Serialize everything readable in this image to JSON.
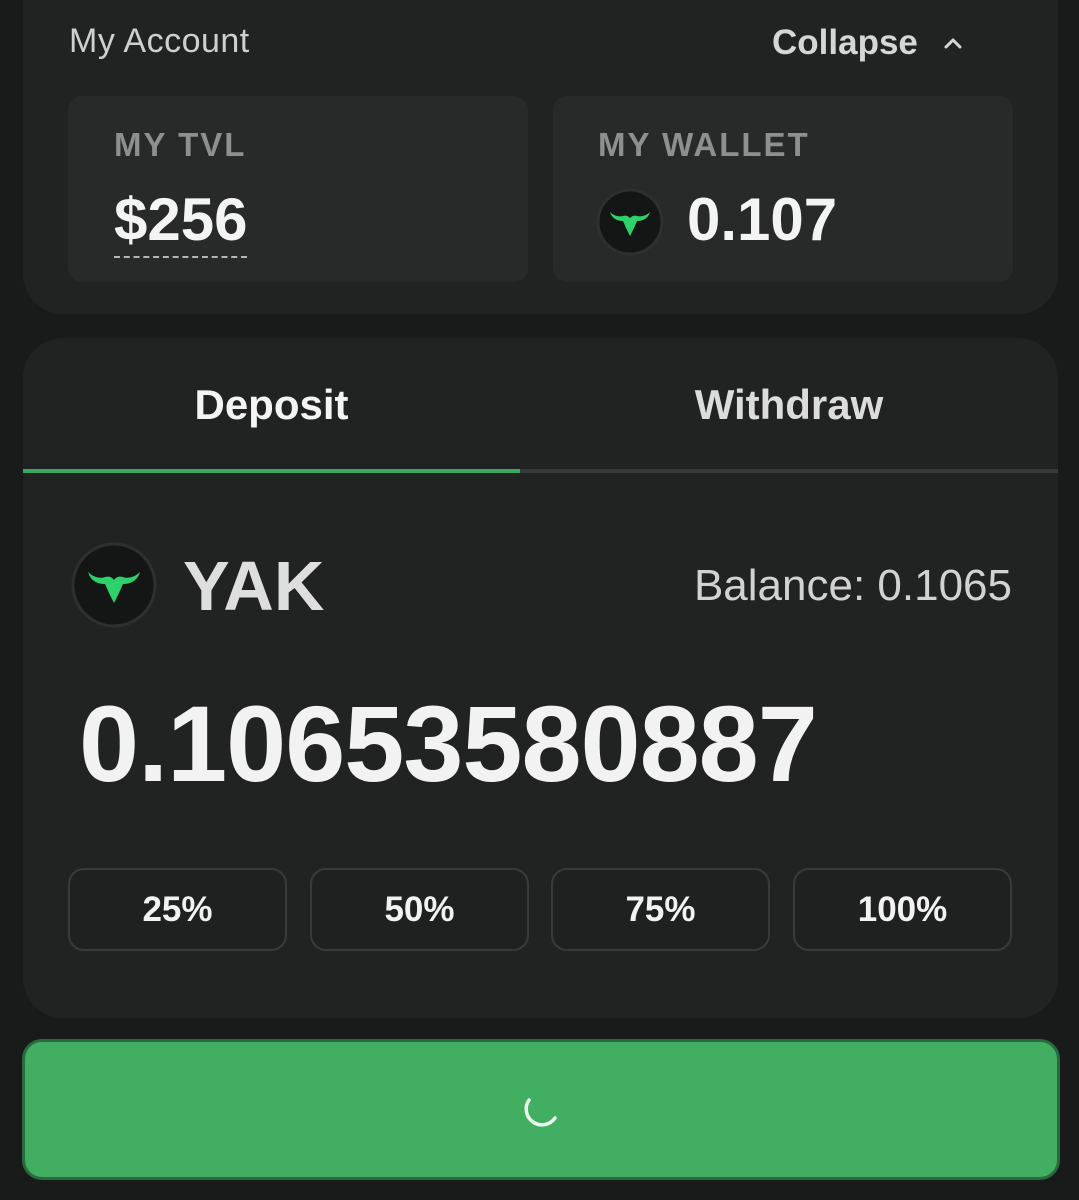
{
  "account": {
    "title": "My Account",
    "collapse_label": "Collapse",
    "tvl": {
      "label": "MY TVL",
      "value": "$256"
    },
    "wallet": {
      "label": "MY WALLET",
      "value": "0.107",
      "token_icon": "yak-bull-icon"
    }
  },
  "tabs": [
    {
      "label": "Deposit",
      "active": true
    },
    {
      "label": "Withdraw",
      "active": false
    }
  ],
  "deposit": {
    "token": {
      "name": "YAK",
      "icon": "yak-bull-icon"
    },
    "balance_text": "Balance: 0.1065",
    "amount_value": "0.10653580887",
    "percent_buttons": [
      "25%",
      "50%",
      "75%",
      "100%"
    ]
  },
  "submit": {
    "state": "loading",
    "icon": "spinner-icon"
  },
  "colors": {
    "accent": "#41ae62",
    "tab_active_line": "#3aa860",
    "card_bg": "#212322",
    "page_bg": "#181b1a",
    "icon_green": "#2fd16a"
  }
}
